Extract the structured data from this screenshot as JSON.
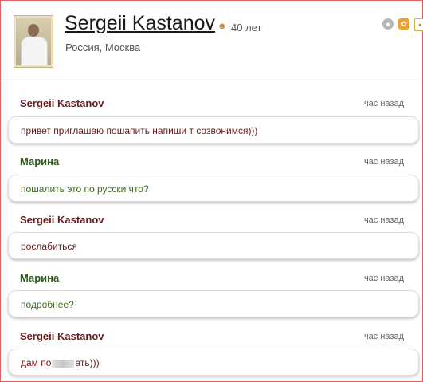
{
  "profile": {
    "name": "Sergeii Kastanov",
    "age": "40 лет",
    "location": "Россия, Москва"
  },
  "header_icons": [
    "privacy-icon",
    "gift-icon",
    "extra-icon"
  ],
  "messages": [
    {
      "author": "Sergeii Kastanov",
      "time": "час назад",
      "text": "привет приглашаю пошапить напиши т созвонимся)))"
    },
    {
      "author": "Марина",
      "time": "час назад",
      "text": "пошалить это по русски что?"
    },
    {
      "author": "Sergeii Kastanov",
      "time": "час назад",
      "text": "рослабиться"
    },
    {
      "author": "Марина",
      "time": "час назад",
      "text": "подробнее?"
    },
    {
      "author": "Sergeii Kastanov",
      "time": "час назад",
      "text_before": "дам по",
      "text_after": "ать)))"
    }
  ],
  "colors": {
    "sergeii": "#6a1a1a",
    "marina": "#2f5a1a",
    "frame_border": "#e06060"
  }
}
